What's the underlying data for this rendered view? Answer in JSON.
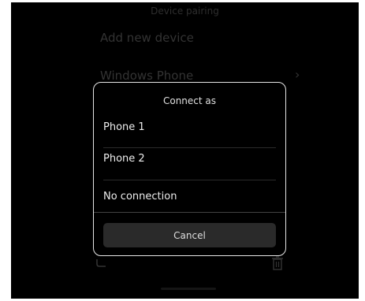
{
  "background": {
    "title": "Device pairing",
    "items": [
      {
        "label": "Add new device"
      },
      {
        "label": "Windows Phone"
      }
    ]
  },
  "dialog": {
    "title": "Connect as",
    "options": [
      {
        "label": "Phone 1"
      },
      {
        "label": "Phone 2"
      },
      {
        "label": "No connection"
      }
    ],
    "cancel_label": "Cancel"
  },
  "icons": {
    "chevron": "chevron-right-icon",
    "back": "back-arrow-icon",
    "trash": "trash-icon"
  }
}
